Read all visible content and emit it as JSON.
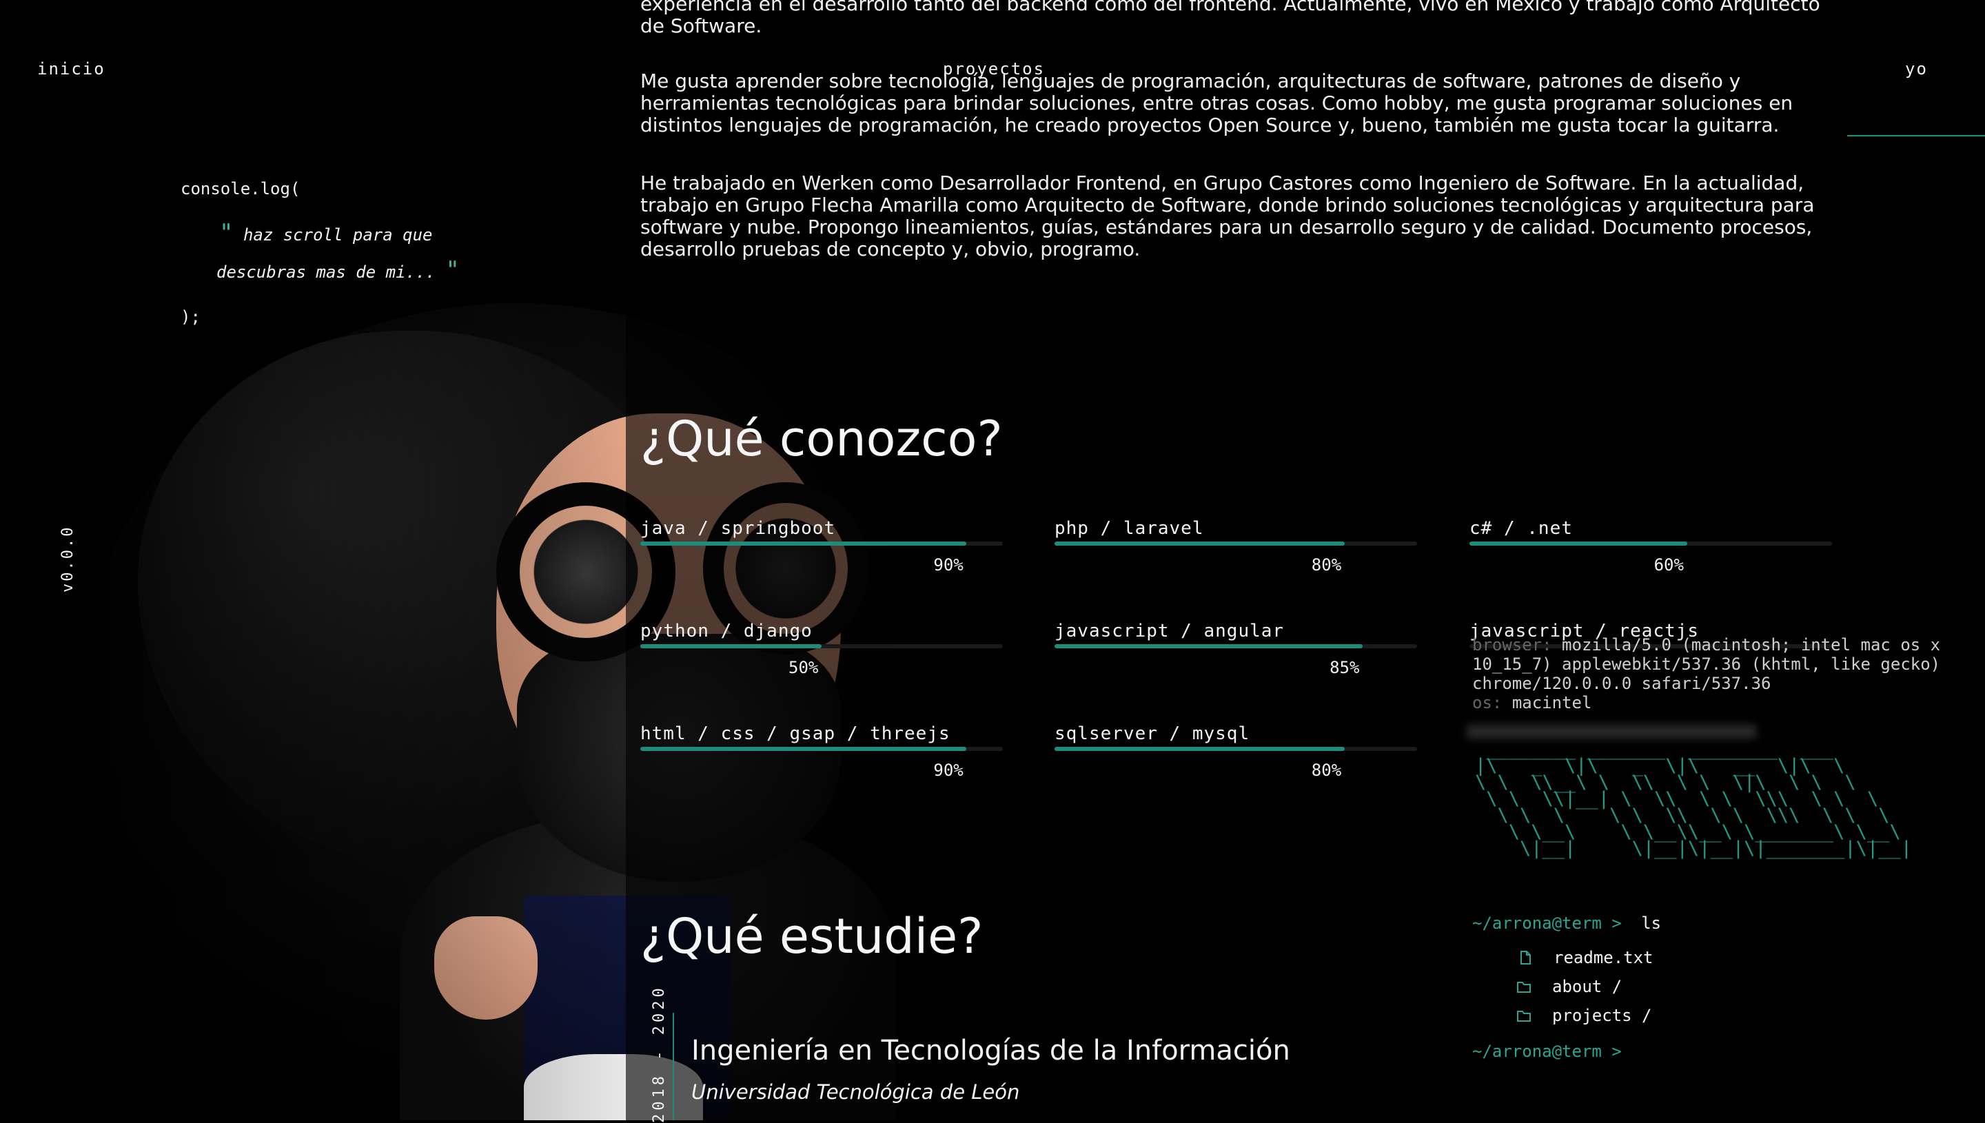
{
  "nav": {
    "inicio": "inicio",
    "proyectos": "proyectos",
    "yo": "yo"
  },
  "console": {
    "open": "console.log(",
    "quote_open": "\"",
    "line1": "haz scroll para que",
    "line2": "descubras mas de mi...",
    "quote_close": "\"",
    "close": ");"
  },
  "version": "v0.0.0",
  "about": {
    "p0": "experiencia en el desarrollo tanto del backend como del frontend. Actualmente, vivo en México y trabajo como Arquitecto de Software.",
    "p1": "Me gusta aprender sobre tecnología, lenguajes de programación, arquitecturas de software, patrones de diseño y herramientas tecnológicas para brindar soluciones, entre otras cosas. Como hobby, me gusta programar soluciones en distintos lenguajes de programación, he creado proyectos Open Source y, bueno, también me gusta tocar la guitarra.",
    "p2": "He trabajado en Werken como Desarrollador Frontend, en Grupo Castores como Ingeniero de Software. En la actualidad, trabajo en Grupo Flecha Amarilla como Arquitecto de Software, donde brindo soluciones tecnológicas y arquitectura para software y nube. Propongo lineamientos, guías, estándares para un desarrollo seguro y de calidad. Documento procesos, desarrollo pruebas de concepto y, obvio, programo."
  },
  "skills_title": "¿Qué conozco?",
  "skills": [
    {
      "name": "java / springboot",
      "pct": "90%",
      "value": 0.9
    },
    {
      "name": "php / laravel",
      "pct": "80%",
      "value": 0.8
    },
    {
      "name": "c# / .net",
      "pct": "60%",
      "value": 0.6
    },
    {
      "name": "python / django",
      "pct": "50%",
      "value": 0.5
    },
    {
      "name": "javascript / angular",
      "pct": "85%",
      "value": 0.85
    },
    {
      "name": "javascript / reactjs",
      "pct": "",
      "value": 0.0
    },
    {
      "name": "html / css / gsap / threejs",
      "pct": "90%",
      "value": 0.9
    },
    {
      "name": "sqlserver / mysql",
      "pct": "80%",
      "value": 0.8
    }
  ],
  "terminal": {
    "browser_key": "browser:",
    "browser_val": "mozilla/5.0 (macintosh; intel mac os x 10_15_7) applewebkit/537.36 (khtml, like gecko) chrome/120.0.0.0 safari/537.36",
    "os_key": "os:",
    "os_val": "macintel",
    "prompt": "~/arrona@term >",
    "cmd": "ls",
    "items": [
      {
        "name": "readme.txt",
        "icon": "file-icon"
      },
      {
        "name": "about /",
        "icon": "folder-icon"
      },
      {
        "name": "projects /",
        "icon": "folder-icon"
      }
    ],
    "prompt2": "~/arrona@term >"
  },
  "study_title": "¿Qué estudie?",
  "study": {
    "years": "2018 - 2020",
    "degree": "Ingeniería en Tecnologías de la Información",
    "school": "Universidad Tecnológica de León"
  },
  "colors": {
    "accent": "#1f8c7b",
    "background": "#000000"
  }
}
